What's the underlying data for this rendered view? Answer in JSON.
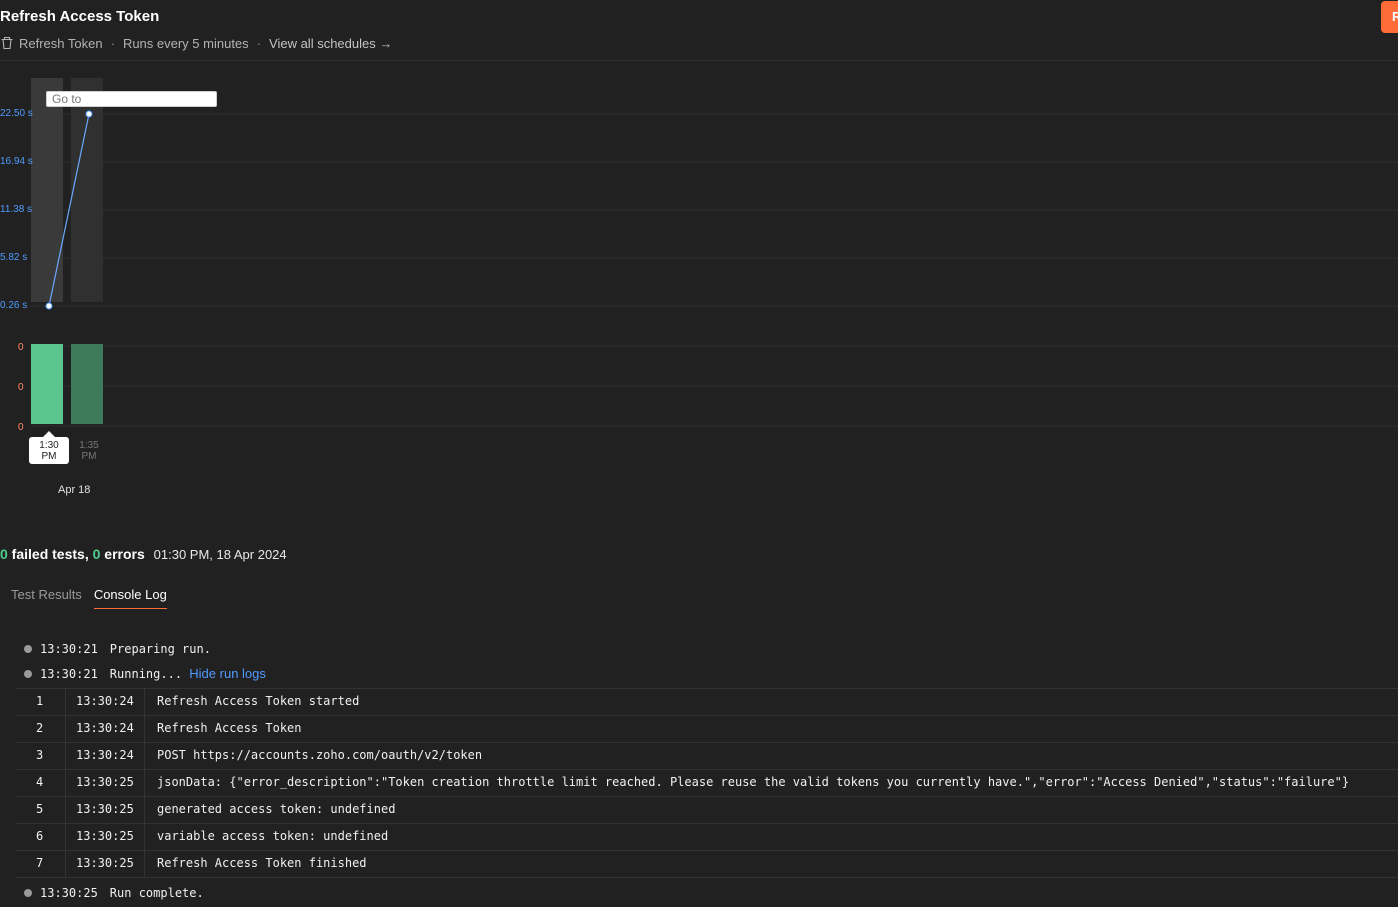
{
  "header": {
    "title": "Refresh Access Token",
    "action_label": "R",
    "collection": "Refresh Token",
    "schedule": "Runs every 5 minutes",
    "view_all": "View all schedules →"
  },
  "colors": {
    "accent": "#ff6c37",
    "success": "#4cce8e",
    "link": "#4f9bff",
    "error_axis": "#ff8a65"
  },
  "chart": {
    "goto_placeholder": "Go to",
    "y_ticks": [
      "22.50 s",
      "16.94 s",
      "11.38 s",
      "5.82 s",
      "0.26 s"
    ],
    "error_ticks": [
      "0",
      "0",
      "0"
    ],
    "runs": [
      {
        "label_time": "1:30",
        "label_ampm": "PM"
      },
      {
        "label_time": "1:35",
        "label_ampm": "PM"
      }
    ],
    "date": "Apr 18"
  },
  "chart_data": {
    "type": "line",
    "categories": [
      "1:30 PM",
      "1:35 PM"
    ],
    "series": [
      {
        "values": [
          0.26,
          22.5
        ]
      }
    ],
    "y_ticks": [
      22.5,
      16.94,
      11.38,
      5.82,
      0.26
    ],
    "ylim": [
      0.26,
      22.5
    ],
    "errors": [
      0,
      0
    ],
    "grid": true
  },
  "summary": {
    "failed_count": "0",
    "failed_label": " failed tests, ",
    "error_count": "0",
    "error_label": " errors",
    "timestamp": "01:30 PM, 18 Apr 2024"
  },
  "tabs": [
    {
      "label": "Test Results",
      "active": false
    },
    {
      "label": "Console Log",
      "active": true
    }
  ],
  "log": {
    "prep": {
      "time": "13:30:21",
      "text": "Preparing run."
    },
    "running": {
      "time": "13:30:21",
      "text": "Running...",
      "link": "Hide run logs"
    },
    "rows": [
      {
        "n": "1",
        "time": "13:30:24",
        "msg": "Refresh Access Token started"
      },
      {
        "n": "2",
        "time": "13:30:24",
        "msg": "Refresh Access Token"
      },
      {
        "n": "3",
        "time": "13:30:24",
        "msg": "POST https://accounts.zoho.com/oauth/v2/token"
      },
      {
        "n": "4",
        "time": "13:30:25",
        "msg": "jsonData: {\"error_description\":\"Token creation throttle limit reached. Please reuse the valid tokens you currently have.\",\"error\":\"Access Denied\",\"status\":\"failure\"}"
      },
      {
        "n": "5",
        "time": "13:30:25",
        "msg": "generated access token: undefined"
      },
      {
        "n": "6",
        "time": "13:30:25",
        "msg": "variable access token: undefined"
      },
      {
        "n": "7",
        "time": "13:30:25",
        "msg": "Refresh Access Token finished"
      }
    ],
    "complete": {
      "time": "13:30:25",
      "text": "Run complete."
    }
  }
}
